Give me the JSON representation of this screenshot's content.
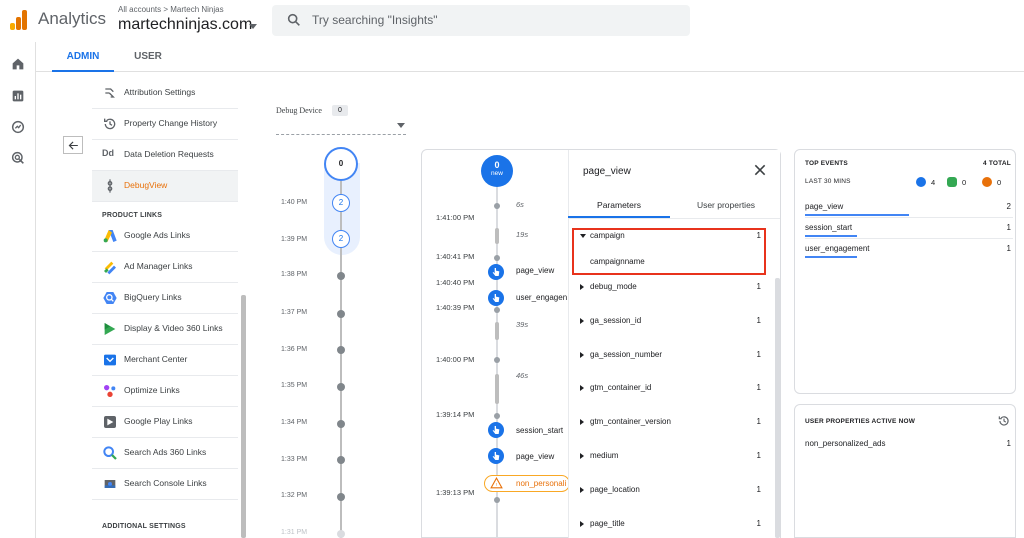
{
  "header": {
    "app_name": "Analytics",
    "breadcrumb": "All accounts > Martech Ninjas",
    "account": "martechninjas.com",
    "search_placeholder": "Try searching \"Insights\"",
    "logo_colors": [
      "#f9ab00",
      "#e37400",
      "#e37400"
    ]
  },
  "rail": {
    "icons": [
      "home-icon",
      "reports-icon",
      "explore-icon",
      "advertising-icon"
    ]
  },
  "tabs": {
    "admin": "ADMIN",
    "user": "USER"
  },
  "nav": {
    "items_top": [
      {
        "label": "Attribution Settings",
        "icon": "attribution-icon"
      },
      {
        "label": "Property Change History",
        "icon": "history-icon"
      },
      {
        "label": "Data Deletion Requests",
        "icon": "dd-icon"
      },
      {
        "label": "DebugView",
        "icon": "debugview-icon",
        "active": true
      }
    ],
    "section_product_links": "PRODUCT LINKS",
    "product_links": [
      {
        "label": "Google Ads Links",
        "icon": "google-ads-icon"
      },
      {
        "label": "Ad Manager Links",
        "icon": "ad-manager-icon"
      },
      {
        "label": "BigQuery Links",
        "icon": "bigquery-icon"
      },
      {
        "label": "Display & Video 360 Links",
        "icon": "dv360-icon"
      },
      {
        "label": "Merchant Center",
        "icon": "merchant-center-icon"
      },
      {
        "label": "Optimize Links",
        "icon": "optimize-icon"
      },
      {
        "label": "Google Play Links",
        "icon": "google-play-icon"
      },
      {
        "label": "Search Ads 360 Links",
        "icon": "search-ads-icon"
      },
      {
        "label": "Search Console Links",
        "icon": "search-console-icon"
      }
    ],
    "section_additional": "ADDITIONAL SETTINGS"
  },
  "debug_device": {
    "label": "Debug Device",
    "count": "0"
  },
  "minutes": {
    "top_count": "0",
    "rows": [
      {
        "label": "1:40 PM",
        "badge": "2"
      },
      {
        "label": "1:39 PM",
        "badge": "2"
      },
      {
        "label": "1:38 PM"
      },
      {
        "label": "1:37 PM"
      },
      {
        "label": "1:36 PM"
      },
      {
        "label": "1:35 PM"
      },
      {
        "label": "1:34 PM"
      },
      {
        "label": "1:33 PM"
      },
      {
        "label": "1:32 PM"
      },
      {
        "label": "1:31 PM"
      }
    ]
  },
  "seconds": {
    "top_count": "0",
    "top_label": "new",
    "times": [
      "1:41:00 PM",
      "1:40:41 PM",
      "1:40:40 PM",
      "1:40:39 PM",
      "1:40:00 PM",
      "1:39:14 PM",
      "1:39:13 PM"
    ],
    "gaps": [
      "6s",
      "19s",
      "39s",
      "46s"
    ],
    "events": [
      "page_view",
      "user_engagen",
      "session_start",
      "page_view"
    ],
    "user_prop_event": "non_personali"
  },
  "detail": {
    "title": "page_view",
    "tab_parameters": "Parameters",
    "tab_user_properties": "User properties",
    "expanded_value": "campaignname",
    "params": [
      {
        "name": "campaign",
        "count": "1"
      },
      {
        "name": "debug_mode",
        "count": "1"
      },
      {
        "name": "ga_session_id",
        "count": "1"
      },
      {
        "name": "ga_session_number",
        "count": "1"
      },
      {
        "name": "gtm_container_id",
        "count": "1"
      },
      {
        "name": "gtm_container_version",
        "count": "1"
      },
      {
        "name": "medium",
        "count": "1"
      },
      {
        "name": "page_location",
        "count": "1"
      },
      {
        "name": "page_title",
        "count": "1"
      }
    ]
  },
  "top_events": {
    "title": "TOP EVENTS",
    "total": "4 TOTAL",
    "period": "LAST 30 MINS",
    "counts": {
      "blue": "4",
      "green": "0",
      "orange": "0"
    },
    "rows": [
      {
        "name": "page_view",
        "count": "2",
        "share": 0.5
      },
      {
        "name": "session_start",
        "count": "1",
        "share": 0.25
      },
      {
        "name": "user_engagement",
        "count": "1",
        "share": 0.25
      }
    ]
  },
  "user_props": {
    "title": "USER PROPERTIES ACTIVE NOW",
    "rows": [
      {
        "name": "non_personalized_ads",
        "count": "1"
      }
    ]
  }
}
